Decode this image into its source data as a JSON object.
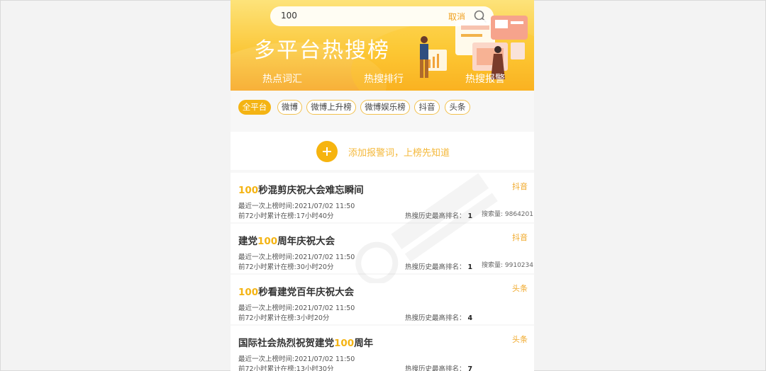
{
  "search": {
    "value": "100",
    "cancel_label": "取消"
  },
  "header": {
    "title": "多平台热搜榜"
  },
  "tabs": [
    {
      "label": "热点词汇"
    },
    {
      "label": "热搜排行"
    },
    {
      "label": "热搜报警"
    }
  ],
  "filters": [
    {
      "label": "全平台",
      "active": true
    },
    {
      "label": "微博"
    },
    {
      "label": "微博上升榜"
    },
    {
      "label": "微博娱乐榜"
    },
    {
      "label": "抖音"
    },
    {
      "label": "头条"
    }
  ],
  "add_alert": {
    "label": "添加报警词，上榜先知道"
  },
  "items": [
    {
      "title_hl": "100",
      "title_rest": "秒混剪庆祝大会难忘瞬间",
      "source": "抖音",
      "last_time": "最近一次上榜时间:2021/07/02 11:50",
      "duration": "前72小时累计在榜:17小时40分",
      "rank_label": "热搜历史最高排名：",
      "rank": "1",
      "search_count": "搜索量: 9864201"
    },
    {
      "title_pre": "建党",
      "title_hl": "100",
      "title_rest": "周年庆祝大会",
      "source": "抖音",
      "last_time": "最近一次上榜时间:2021/07/02 11:50",
      "duration": "前72小时累计在榜:30小时20分",
      "rank_label": "热搜历史最高排名：",
      "rank": "1",
      "search_count": "搜索量: 9910234"
    },
    {
      "title_hl": "100",
      "title_rest": "秒看建党百年庆祝大会",
      "source": "头条",
      "last_time": "最近一次上榜时间:2021/07/02 11:50",
      "duration": "前72小时累计在榜:3小时20分",
      "rank_label": "热搜历史最高排名：",
      "rank": "4",
      "search_count": ""
    },
    {
      "title_pre": "国际社会热烈祝贺建党",
      "title_hl": "100",
      "title_rest": "周年",
      "source": "头条",
      "last_time": "最近一次上榜时间:2021/07/02 11:50",
      "duration": "前72小时累计在榜:13小时30分",
      "rank_label": "热搜历史最高排名：",
      "rank": "7",
      "search_count": ""
    }
  ],
  "colors": {
    "accent": "#f4b414",
    "header_top": "#fde37a",
    "header_bottom": "#f7a61e"
  }
}
